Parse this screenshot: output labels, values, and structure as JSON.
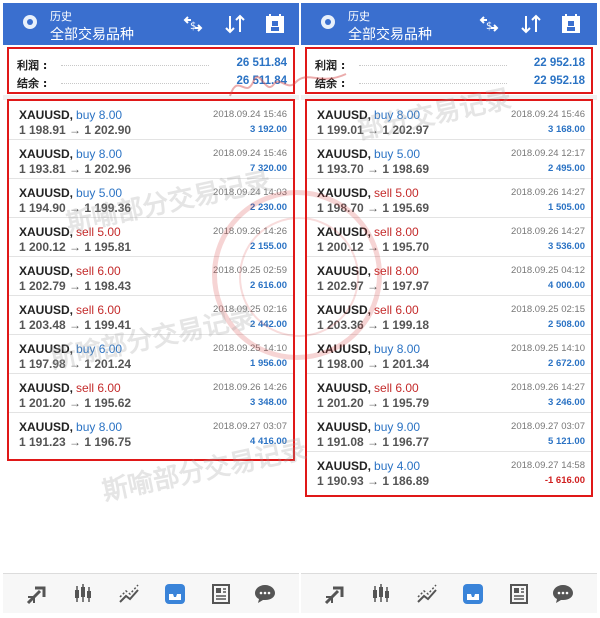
{
  "left": {
    "header": {
      "line1": "历史",
      "line2": "全部交易品种"
    },
    "summary": {
      "profit_label": "利润 :",
      "profit_value": "26 511.84",
      "balance_label": "结余 :",
      "balance_value": "26 511.84"
    },
    "trades": [
      {
        "symbol": "XAUUSD,",
        "side": "buy 8.00",
        "type": "buy",
        "prices": "1 198.91 → 1 202.90",
        "date": "2018.09.24 15:46",
        "profit": "3 192.00"
      },
      {
        "symbol": "XAUUSD,",
        "side": "buy 8.00",
        "type": "buy",
        "prices": "1 193.81 → 1 202.96",
        "date": "2018.09.24 15:46",
        "profit": "7 320.00"
      },
      {
        "symbol": "XAUUSD,",
        "side": "buy 5.00",
        "type": "buy",
        "prices": "1 194.90 → 1 199.36",
        "date": "2018.09.24 14:03",
        "profit": "2 230.00"
      },
      {
        "symbol": "XAUUSD,",
        "side": "sell 5.00",
        "type": "sell",
        "prices": "1 200.12 → 1 195.81",
        "date": "2018.09.26 14:26",
        "profit": "2 155.00"
      },
      {
        "symbol": "XAUUSD,",
        "side": "sell 6.00",
        "type": "sell",
        "prices": "1 202.79 → 1 198.43",
        "date": "2018.09.25 02:59",
        "profit": "2 616.00"
      },
      {
        "symbol": "XAUUSD,",
        "side": "sell 6.00",
        "type": "sell",
        "prices": "1 203.48 → 1 199.41",
        "date": "2018.09.25 02:16",
        "profit": "2 442.00"
      },
      {
        "symbol": "XAUUSD,",
        "side": "buy 6.00",
        "type": "buy",
        "prices": "1 197.98 → 1 201.24",
        "date": "2018.09.25 14:10",
        "profit": "1 956.00"
      },
      {
        "symbol": "XAUUSD,",
        "side": "sell 6.00",
        "type": "sell",
        "prices": "1 201.20 → 1 195.62",
        "date": "2018.09.26 14:26",
        "profit": "3 348.00"
      },
      {
        "symbol": "XAUUSD,",
        "side": "buy 8.00",
        "type": "buy",
        "prices": "1 191.23 → 1 196.75",
        "date": "2018.09.27 03:07",
        "profit": "4 416.00"
      }
    ]
  },
  "right": {
    "header": {
      "line1": "历史",
      "line2": "全部交易品种"
    },
    "summary": {
      "profit_label": "利润 :",
      "profit_value": "22 952.18",
      "balance_label": "结余 :",
      "balance_value": "22 952.18"
    },
    "trades": [
      {
        "symbol": "XAUUSD,",
        "side": "buy 8.00",
        "type": "buy",
        "prices": "1 199.01 → 1 202.97",
        "date": "2018.09.24 15:46",
        "profit": "3 168.00"
      },
      {
        "symbol": "XAUUSD,",
        "side": "buy 5.00",
        "type": "buy",
        "prices": "1 193.70 → 1 198.69",
        "date": "2018.09.24 12:17",
        "profit": "2 495.00"
      },
      {
        "symbol": "XAUUSD,",
        "side": "sell 5.00",
        "type": "sell",
        "prices": "1 198.70 → 1 195.69",
        "date": "2018.09.26 14:27",
        "profit": "1 505.00"
      },
      {
        "symbol": "XAUUSD,",
        "side": "sell 8.00",
        "type": "sell",
        "prices": "1 200.12 → 1 195.70",
        "date": "2018.09.26 14:27",
        "profit": "3 536.00"
      },
      {
        "symbol": "XAUUSD,",
        "side": "sell 8.00",
        "type": "sell",
        "prices": "1 202.97 → 1 197.97",
        "date": "2018.09.25 04:12",
        "profit": "4 000.00"
      },
      {
        "symbol": "XAUUSD,",
        "side": "sell 6.00",
        "type": "sell",
        "prices": "1 203.36 → 1 199.18",
        "date": "2018.09.25 02:15",
        "profit": "2 508.00"
      },
      {
        "symbol": "XAUUSD,",
        "side": "buy 8.00",
        "type": "buy",
        "prices": "1 198.00 → 1 201.34",
        "date": "2018.09.25 14:10",
        "profit": "2 672.00"
      },
      {
        "symbol": "XAUUSD,",
        "side": "sell 6.00",
        "type": "sell",
        "prices": "1 201.20 → 1 195.79",
        "date": "2018.09.26 14:27",
        "profit": "3 246.00"
      },
      {
        "symbol": "XAUUSD,",
        "side": "buy 9.00",
        "type": "buy",
        "prices": "1 191.08 → 1 196.77",
        "date": "2018.09.27 03:07",
        "profit": "5 121.00"
      },
      {
        "symbol": "XAUUSD,",
        "side": "buy 4.00",
        "type": "buy",
        "prices": "1 190.93 → 1 186.89",
        "date": "2018.09.27 14:58",
        "profit": "-1 616.00"
      }
    ]
  },
  "watermarks": {
    "w1": "斯喻部分交易记录",
    "w2": "斯喻部分交易记录",
    "w3": "斯喻部分交易记录",
    "w4": "部分交易记录"
  },
  "colors": {
    "header_bg": "#3a6fcf",
    "buy": "#2b73c4",
    "sell": "#c42b2b",
    "highlight_border": "#e01818"
  },
  "icons": [
    "new-order-icon",
    "quotes-icon",
    "chart-icon",
    "trade-icon",
    "history-icon",
    "news-icon",
    "chat-icon"
  ]
}
